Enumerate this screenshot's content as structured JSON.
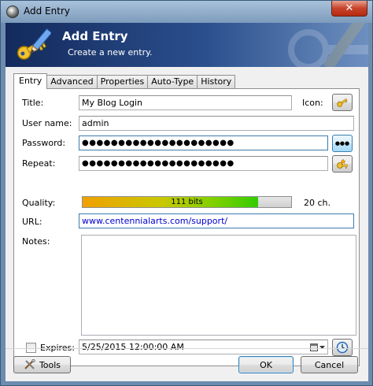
{
  "window": {
    "title": "Add Entry",
    "close_glyph": "✕"
  },
  "banner": {
    "title": "Add Entry",
    "subtitle": "Create a new entry.",
    "icon": "key-pencil-icon"
  },
  "tabs": [
    {
      "label": "Entry",
      "active": true
    },
    {
      "label": "Advanced",
      "active": false
    },
    {
      "label": "Properties",
      "active": false
    },
    {
      "label": "Auto-Type",
      "active": false
    },
    {
      "label": "History",
      "active": false
    }
  ],
  "form": {
    "title_label": "Title:",
    "title_value": "My Blog Login",
    "icon_label": "Icon:",
    "username_label": "User name:",
    "username_value": "admin",
    "password_label": "Password:",
    "password_value": "●●●●●●●●●●●●●●●●●●●●●",
    "show_password_glyph": "●●●",
    "repeat_label": "Repeat:",
    "repeat_value": "●●●●●●●●●●●●●●●●●●●●●",
    "quality_label": "Quality:",
    "quality_bits": "111 bits",
    "quality_fraction": 0.84,
    "quality_chars": "20 ch.",
    "url_label": "URL:",
    "url_value": "www.centennialarts.com/support/",
    "notes_label": "Notes:",
    "notes_value": "",
    "expires_label": "Expires:",
    "expires_checked": false,
    "expires_value": "5/25/2015 12:00:00 AM"
  },
  "buttons": {
    "tools": "Tools",
    "ok": "OK",
    "cancel": "Cancel"
  },
  "colors": {
    "banner_dark": "#132a5c",
    "url_text": "#0000cc",
    "quality_start": "#f0a000",
    "quality_end": "#33cc00"
  }
}
